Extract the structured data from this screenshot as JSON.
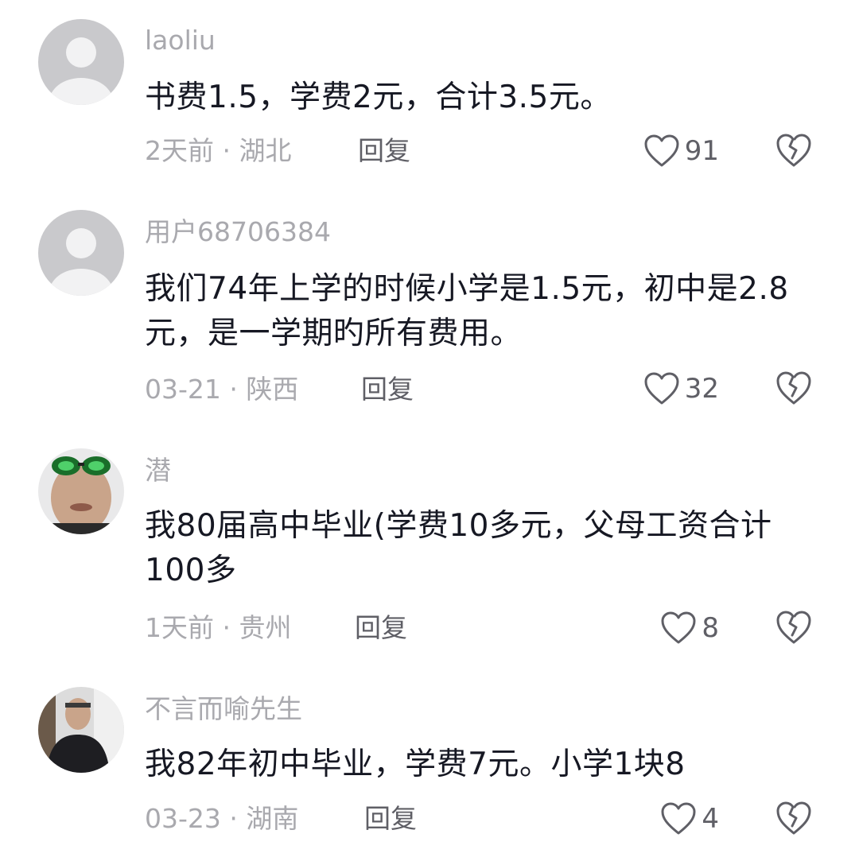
{
  "comments": [
    {
      "username": "laoliu",
      "text": "书费1.5，学费2元，合计3.5元。",
      "time": "2天前",
      "location": "湖北",
      "reply_label": "回复",
      "likes": "91",
      "avatar": "default-avatar"
    },
    {
      "username": "用户68706384",
      "text": "我们74年上学的时候小学是1.5元，初中是2.8元，是一学期旳所有费用。",
      "time": "03-21",
      "location": "陕西",
      "reply_label": "回复",
      "likes": "32",
      "avatar": "default-avatar"
    },
    {
      "username": "潜",
      "text": "我80届高中毕业(学费10多元，父母工资合计100多",
      "time": "1天前",
      "location": "贵州",
      "reply_label": "回复",
      "likes": "8",
      "avatar": "photo-avatar-sunglasses"
    },
    {
      "username": "不言而喻先生",
      "text": "我82年初中毕业，学费7元。小学1块8",
      "time": "03-23",
      "location": "湖南",
      "reply_label": "回复",
      "likes": "4",
      "avatar": "photo-avatar-man"
    }
  ],
  "meta_separator": " · ",
  "colors": {
    "secondary_text": "#a9a9ae",
    "primary_text": "#161823",
    "action_text": "#5f5f66",
    "default_avatar_bg": "#c8c8cc"
  }
}
